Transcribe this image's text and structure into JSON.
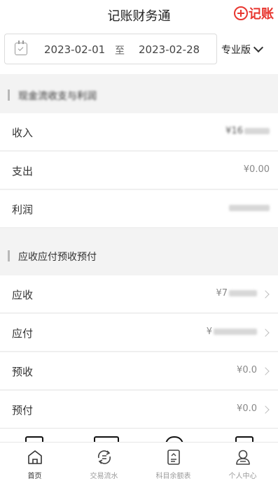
{
  "header": {
    "title": "记账财务通",
    "add_label": "记账"
  },
  "date_filter": {
    "start": "2023-02-01",
    "separator": "至",
    "end": "2023-02-28",
    "edition": "专业版"
  },
  "sections": [
    {
      "title": "现金流收支与利润",
      "rows": [
        {
          "label": "收入",
          "value": "¥16"
        },
        {
          "label": "支出",
          "value": "¥0.00"
        },
        {
          "label": "利润",
          "value": ""
        }
      ]
    },
    {
      "title": "应收应付预收预付",
      "rows": [
        {
          "label": "应收",
          "value": "¥7"
        },
        {
          "label": "应付",
          "value": "¥"
        },
        {
          "label": "预收",
          "value": "¥0.0"
        },
        {
          "label": "预付",
          "value": "¥0.0"
        }
      ]
    }
  ],
  "tabs": [
    {
      "label": "首页",
      "icon": "home-icon",
      "active": true
    },
    {
      "label": "交易流水",
      "icon": "exchange-icon",
      "active": false
    },
    {
      "label": "科目余额表",
      "icon": "ledger-icon",
      "active": false
    },
    {
      "label": "个人中心",
      "icon": "user-icon",
      "active": false
    }
  ],
  "colors": {
    "accent": "#e8362f",
    "background": "#f3f3f3"
  }
}
